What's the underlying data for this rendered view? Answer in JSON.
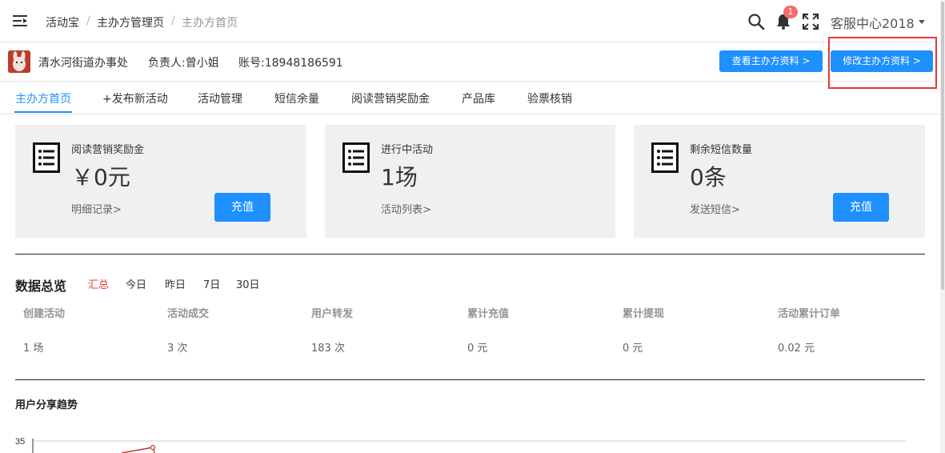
{
  "breadcrumb": [
    "活动宝",
    "主办方管理页",
    "主办方首页"
  ],
  "header": {
    "notification_count": "1",
    "user": "客服中心2018",
    "icons": [
      "menu-fold-icon",
      "search-icon",
      "bell-icon",
      "fullscreen-icon",
      "caret-down-icon"
    ]
  },
  "organizer": {
    "name": "清水河街道办事处",
    "contact": "负责人:曾小姐",
    "account": "账号:18948186591",
    "view_button": "查看主办方资料 >",
    "edit_button": "修改主办方资料 >"
  },
  "tabs": [
    "主办方首页",
    "+发布新活动",
    "活动管理",
    "短信余量",
    "阅读营销奖励金",
    "产品库",
    "验票核销"
  ],
  "cards": [
    {
      "title": "阅读营销奖励金",
      "value": "￥0元",
      "link": "明细记录>",
      "button": "充值"
    },
    {
      "title": "进行中活动",
      "value": "1场",
      "link": "活动列表>",
      "button": ""
    },
    {
      "title": "剩余短信数量",
      "value": "0条",
      "link": "发送短信>",
      "button": "充值"
    }
  ],
  "overview": {
    "title": "数据总览",
    "periods": [
      "汇总",
      "今日",
      "昨日",
      "7日",
      "30日"
    ],
    "stats": [
      {
        "label": "创建活动",
        "value": "1 场"
      },
      {
        "label": "活动成交",
        "value": "3 次"
      },
      {
        "label": "用户转发",
        "value": "183 次"
      },
      {
        "label": "累计充值",
        "value": "0 元"
      },
      {
        "label": "累计提现",
        "value": "0 元"
      },
      {
        "label": "活动累计订单",
        "value": "0.02 元"
      }
    ]
  },
  "trend": {
    "title": "用户分享趋势",
    "y_tick": "35"
  },
  "colors": {
    "accent": "#1e90ff",
    "active_period": "#e53935",
    "highlight": "#e53935"
  }
}
